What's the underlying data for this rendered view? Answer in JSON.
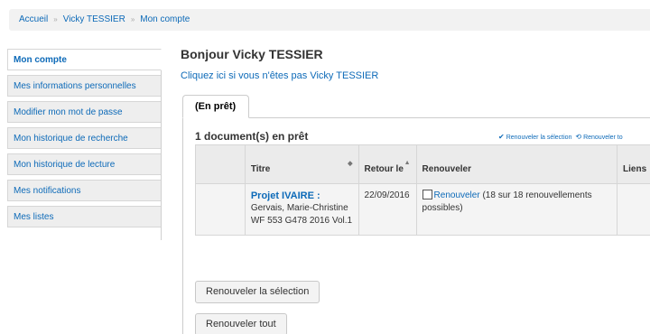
{
  "breadcrumb": {
    "home": "Accueil",
    "user": "Vicky TESSIER",
    "current": "Mon compte"
  },
  "sidebar": {
    "items": [
      {
        "label": "Mon compte"
      },
      {
        "label": "Mes informations personnelles"
      },
      {
        "label": "Modifier mon mot de passe"
      },
      {
        "label": "Mon historique de recherche"
      },
      {
        "label": "Mon historique de lecture"
      },
      {
        "label": "Mes notifications"
      },
      {
        "label": "Mes listes"
      }
    ]
  },
  "main": {
    "greeting": "Bonjour Vicky TESSIER",
    "not_you_link": "Cliquez ici si vous n'êtes pas Vicky TESSIER",
    "tab_label": "(En prêt)",
    "count_heading": "1 document(s) en prêt",
    "renew_selection_link": "Renouveler la sélection",
    "renew_all_link": "Renouveler to"
  },
  "table": {
    "headers": {
      "titre": "Titre",
      "retour": "Retour le",
      "renouveler": "Renouveler",
      "liens": "Liens"
    },
    "rows": [
      {
        "title": "Projet IVAIRE :",
        "author": "Gervais, Marie-Christine",
        "callnumber": "WF 553 G478 2016 Vol.1",
        "due": "22/09/2016",
        "renew_link": "Renouveler",
        "renew_info": "(18 sur 18 renouvellements possibles)"
      }
    ]
  },
  "buttons": {
    "renew_selection": "Renouveler la sélection",
    "renew_all": "Renouveler tout"
  }
}
